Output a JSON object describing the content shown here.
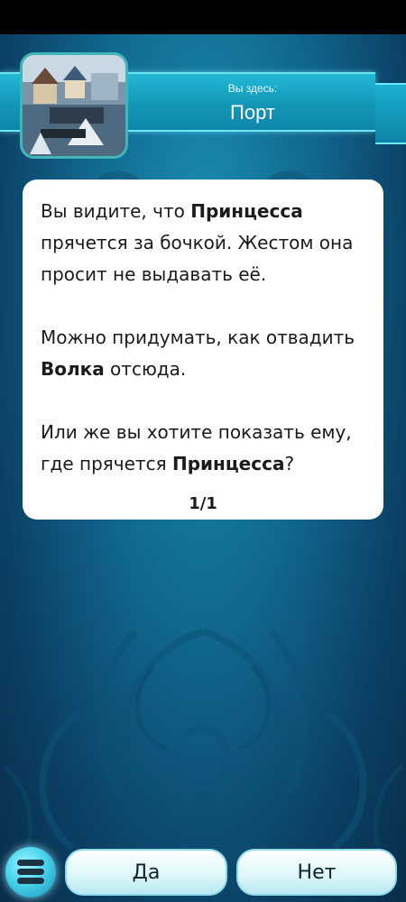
{
  "location": {
    "label": "Вы здесь:",
    "name": "Порт",
    "thumbnail_icon": "port-scene-image"
  },
  "dialog": {
    "p1_before": "Вы видите, что ",
    "p1_bold": "Принцесса",
    "p1_after": " прячется за бочкой. Жестом она просит не выдавать её.",
    "p2_before": "Можно придумать, как отвадить ",
    "p2_bold": "Волка",
    "p2_after": " отсюда.",
    "p3_before": "Или же вы хотите показать ему, где прячется ",
    "p3_bold": "Принцесса",
    "p3_after": "?",
    "page": "1/1"
  },
  "actions": {
    "menu_icon": "menu-icon",
    "yes_label": "Да",
    "no_label": "Нет"
  },
  "colors": {
    "background": "#11688f",
    "banner": "#1396b9",
    "banner_border": "#6fe6f5",
    "card": "#ffffff",
    "button_glow": "#48d3ec"
  }
}
